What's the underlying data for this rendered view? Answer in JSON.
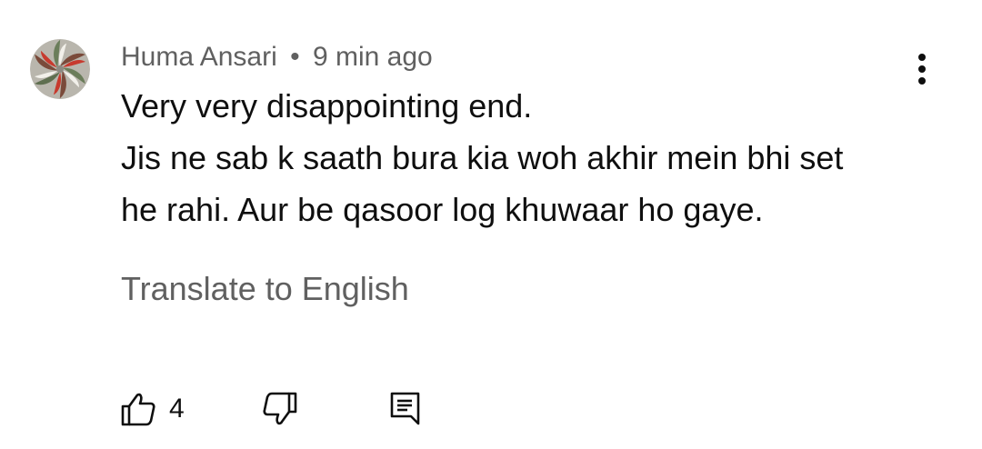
{
  "comment": {
    "author": "Huma Ansari",
    "separator": "•",
    "time": "9 min ago",
    "body_lines": [
      "Very very disappointing end.",
      "Jis ne sab k saath bura kia woh akhir mein bhi set",
      "he rahi. Aur be qasoor log khuwaar ho gaye."
    ],
    "translate_label": "Translate to English",
    "like_count": "4"
  },
  "icons": {
    "avatar": "avatar-pinwheel",
    "more": "more-vertical-icon",
    "like": "thumbs-up-icon",
    "dislike": "thumbs-down-icon",
    "reply": "reply-comment-icon"
  },
  "colors": {
    "primary_text": "#0f0f0f",
    "secondary_text": "#606060",
    "background": "#ffffff"
  }
}
